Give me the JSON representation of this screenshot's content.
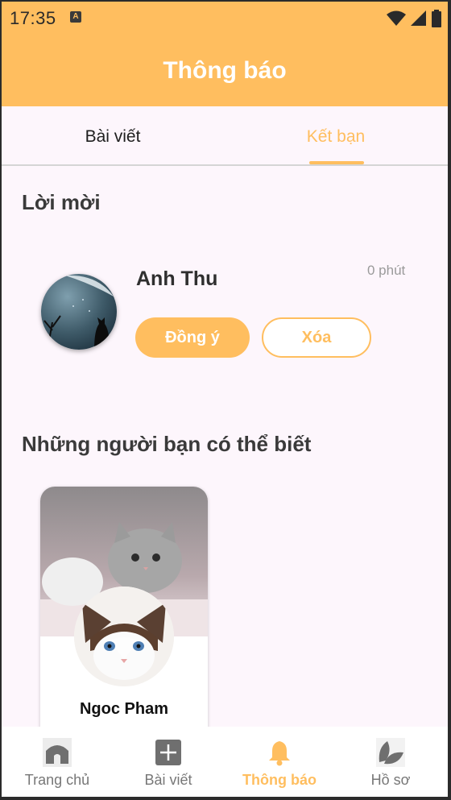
{
  "status_bar": {
    "time": "17:35",
    "notif_glyph": "A"
  },
  "app_bar": {
    "title": "Thông báo"
  },
  "tabs": [
    {
      "label": "Bài viết",
      "active": false
    },
    {
      "label": "Kết bạn",
      "active": true
    }
  ],
  "invites": {
    "title": "Lời mời",
    "items": [
      {
        "name": "Anh Thu",
        "time": "0 phút",
        "accept_label": "Đồng ý",
        "delete_label": "Xóa"
      }
    ]
  },
  "suggestions": {
    "title": "Những người bạn có thể biết",
    "items": [
      {
        "name": "Ngoc Pham"
      }
    ]
  },
  "bottom_nav": [
    {
      "label": "Trang chủ",
      "icon": "home-icon",
      "active": false
    },
    {
      "label": "Bài viết",
      "icon": "add-post-icon",
      "active": false
    },
    {
      "label": "Thông báo",
      "icon": "bell-icon",
      "active": true
    },
    {
      "label": "Hồ sơ",
      "icon": "leaf-icon",
      "active": false
    }
  ],
  "colors": {
    "accent": "#ffbe5f",
    "background": "#fdf6fc",
    "text_dark": "#3a3a3a",
    "muted": "#9a9a9a"
  }
}
